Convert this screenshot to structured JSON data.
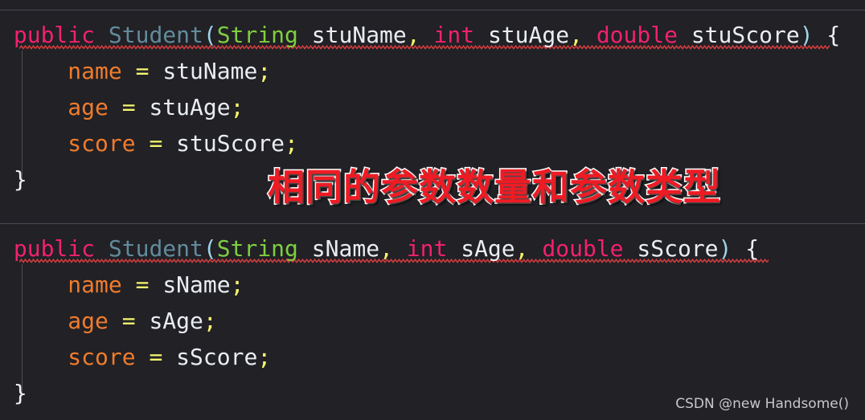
{
  "editor": {
    "background_color": "#212126",
    "separator_color": "#4a4a52",
    "indent_guide_color": "#4d4d56",
    "squiggle_color": "#d03c3c",
    "blocks": [
      {
        "id": "constructor-stu",
        "lines": [
          {
            "id": "signature",
            "has_error_squiggle": true,
            "tokens": [
              {
                "name": "keyword-public",
                "text": "public",
                "color": "#f2216e"
              },
              {
                "name": "space",
                "text": " ",
                "color": "#e9edf2"
              },
              {
                "name": "type-student",
                "text": "Student",
                "color": "#628b9b"
              },
              {
                "name": "paren-open",
                "text": "(",
                "color": "#9fd4e8"
              },
              {
                "name": "class-string",
                "text": "String",
                "color": "#7fcf3f"
              },
              {
                "name": "space",
                "text": " ",
                "color": "#e9edf2"
              },
              {
                "name": "param-stuname",
                "text": "stuName",
                "color": "#e9edf2"
              },
              {
                "name": "comma",
                "text": ",",
                "color": "#f2f06a"
              },
              {
                "name": "space",
                "text": " ",
                "color": "#e9edf2"
              },
              {
                "name": "keyword-int",
                "text": "int",
                "color": "#f2216e"
              },
              {
                "name": "space",
                "text": " ",
                "color": "#e9edf2"
              },
              {
                "name": "param-stuage",
                "text": "stuAge",
                "color": "#e9edf2"
              },
              {
                "name": "comma",
                "text": ",",
                "color": "#f2f06a"
              },
              {
                "name": "space",
                "text": " ",
                "color": "#e9edf2"
              },
              {
                "name": "keyword-double",
                "text": "double",
                "color": "#f2216e"
              },
              {
                "name": "space",
                "text": " ",
                "color": "#e9edf2"
              },
              {
                "name": "param-stuscore",
                "text": "stuScore",
                "color": "#e9edf2"
              },
              {
                "name": "paren-close",
                "text": ")",
                "color": "#9fd4e8"
              },
              {
                "name": "space",
                "text": " ",
                "color": "#e9edf2"
              },
              {
                "name": "brace-open",
                "text": "{",
                "color": "#f0f0f2"
              }
            ]
          },
          {
            "id": "assign-name",
            "has_error_squiggle": false,
            "indent": "    ",
            "tokens": [
              {
                "name": "field-name",
                "text": "name",
                "color": "#f07c2c"
              },
              {
                "name": "space",
                "text": " ",
                "color": "#e9edf2"
              },
              {
                "name": "operator-assign",
                "text": "=",
                "color": "#f7f56d"
              },
              {
                "name": "space",
                "text": " ",
                "color": "#e9edf2"
              },
              {
                "name": "param-stuname",
                "text": "stuName",
                "color": "#e9edf2"
              },
              {
                "name": "semicolon",
                "text": ";",
                "color": "#f7f56d"
              }
            ]
          },
          {
            "id": "assign-age",
            "has_error_squiggle": false,
            "indent": "    ",
            "tokens": [
              {
                "name": "field-age",
                "text": "age",
                "color": "#f07c2c"
              },
              {
                "name": "space",
                "text": " ",
                "color": "#e9edf2"
              },
              {
                "name": "operator-assign",
                "text": "=",
                "color": "#f7f56d"
              },
              {
                "name": "space",
                "text": " ",
                "color": "#e9edf2"
              },
              {
                "name": "param-stuage",
                "text": "stuAge",
                "color": "#e9edf2"
              },
              {
                "name": "semicolon",
                "text": ";",
                "color": "#f7f56d"
              }
            ]
          },
          {
            "id": "assign-score",
            "has_error_squiggle": false,
            "indent": "    ",
            "tokens": [
              {
                "name": "field-score",
                "text": "score",
                "color": "#f07c2c"
              },
              {
                "name": "space",
                "text": " ",
                "color": "#e9edf2"
              },
              {
                "name": "operator-assign",
                "text": "=",
                "color": "#f7f56d"
              },
              {
                "name": "space",
                "text": " ",
                "color": "#e9edf2"
              },
              {
                "name": "param-stuscore",
                "text": "stuScore",
                "color": "#e9edf2"
              },
              {
                "name": "semicolon",
                "text": ";",
                "color": "#f7f56d"
              }
            ]
          },
          {
            "id": "close-brace",
            "has_error_squiggle": false,
            "tokens": [
              {
                "name": "brace-close",
                "text": "}",
                "color": "#f0f0f2"
              }
            ]
          }
        ]
      },
      {
        "id": "constructor-s",
        "lines": [
          {
            "id": "signature",
            "has_error_squiggle": true,
            "tokens": [
              {
                "name": "keyword-public",
                "text": "public",
                "color": "#f2216e"
              },
              {
                "name": "space",
                "text": " ",
                "color": "#e9edf2"
              },
              {
                "name": "type-student",
                "text": "Student",
                "color": "#628b9b"
              },
              {
                "name": "paren-open",
                "text": "(",
                "color": "#9fd4e8"
              },
              {
                "name": "class-string",
                "text": "String",
                "color": "#7fcf3f"
              },
              {
                "name": "space",
                "text": " ",
                "color": "#e9edf2"
              },
              {
                "name": "param-sname",
                "text": "sName",
                "color": "#e9edf2"
              },
              {
                "name": "comma",
                "text": ",",
                "color": "#f2f06a"
              },
              {
                "name": "space",
                "text": " ",
                "color": "#e9edf2"
              },
              {
                "name": "keyword-int",
                "text": "int",
                "color": "#f2216e"
              },
              {
                "name": "space",
                "text": " ",
                "color": "#e9edf2"
              },
              {
                "name": "param-sage",
                "text": "sAge",
                "color": "#e9edf2"
              },
              {
                "name": "comma",
                "text": ",",
                "color": "#f2f06a"
              },
              {
                "name": "space",
                "text": " ",
                "color": "#e9edf2"
              },
              {
                "name": "keyword-double",
                "text": "double",
                "color": "#f2216e"
              },
              {
                "name": "space",
                "text": " ",
                "color": "#e9edf2"
              },
              {
                "name": "param-sscore",
                "text": "sScore",
                "color": "#e9edf2"
              },
              {
                "name": "paren-close",
                "text": ")",
                "color": "#9fd4e8"
              },
              {
                "name": "space",
                "text": " ",
                "color": "#e9edf2"
              },
              {
                "name": "brace-open",
                "text": "{",
                "color": "#f0f0f2"
              }
            ]
          },
          {
            "id": "assign-name",
            "has_error_squiggle": false,
            "indent": "    ",
            "tokens": [
              {
                "name": "field-name",
                "text": "name",
                "color": "#f07c2c"
              },
              {
                "name": "space",
                "text": " ",
                "color": "#e9edf2"
              },
              {
                "name": "operator-assign",
                "text": "=",
                "color": "#f7f56d"
              },
              {
                "name": "space",
                "text": " ",
                "color": "#e9edf2"
              },
              {
                "name": "param-sname",
                "text": "sName",
                "color": "#e9edf2"
              },
              {
                "name": "semicolon",
                "text": ";",
                "color": "#f7f56d"
              }
            ]
          },
          {
            "id": "assign-age",
            "has_error_squiggle": false,
            "indent": "    ",
            "tokens": [
              {
                "name": "field-age",
                "text": "age",
                "color": "#f07c2c"
              },
              {
                "name": "space",
                "text": " ",
                "color": "#e9edf2"
              },
              {
                "name": "operator-assign",
                "text": "=",
                "color": "#f7f56d"
              },
              {
                "name": "space",
                "text": " ",
                "color": "#e9edf2"
              },
              {
                "name": "param-sage",
                "text": "sAge",
                "color": "#e9edf2"
              },
              {
                "name": "semicolon",
                "text": ";",
                "color": "#f7f56d"
              }
            ]
          },
          {
            "id": "assign-score",
            "has_error_squiggle": false,
            "indent": "    ",
            "tokens": [
              {
                "name": "field-score",
                "text": "score",
                "color": "#f07c2c"
              },
              {
                "name": "space",
                "text": " ",
                "color": "#e9edf2"
              },
              {
                "name": "operator-assign",
                "text": "=",
                "color": "#f7f56d"
              },
              {
                "name": "space",
                "text": " ",
                "color": "#e9edf2"
              },
              {
                "name": "param-sscore",
                "text": "sScore",
                "color": "#e9edf2"
              },
              {
                "name": "semicolon",
                "text": ";",
                "color": "#f7f56d"
              }
            ]
          },
          {
            "id": "close-brace",
            "has_error_squiggle": false,
            "tokens": [
              {
                "name": "brace-close",
                "text": "}",
                "color": "#f0f0f2"
              }
            ]
          }
        ]
      }
    ]
  },
  "annotation": {
    "text": "相同的参数数量和参数类型",
    "fill_color": "#ee1b24",
    "outline_color": "#ffffff"
  },
  "watermark": {
    "text": "CSDN @new Handsome()",
    "color": "#c7c7cc"
  }
}
